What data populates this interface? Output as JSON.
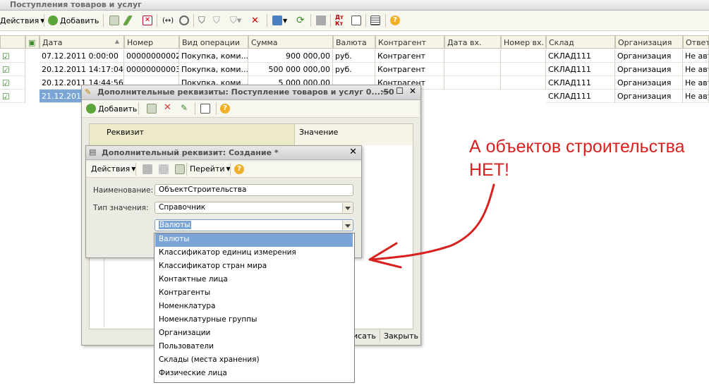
{
  "main_window": {
    "title": "Поступления товаров и услуг"
  },
  "toolbar": {
    "actions": "Действия",
    "add": "Добавить"
  },
  "table": {
    "headers": [
      "Дата",
      "Номер",
      "Вид операции",
      "Сумма",
      "Валюта",
      "Контрагент",
      "Дата вх.",
      "Номер вх.",
      "Склад",
      "Организация",
      "Ответс"
    ],
    "rows": [
      [
        "07.12.2011 0:00:00",
        "00000000002",
        "Покупка, коми...",
        "900 000,00",
        "руб.",
        "Контрагент",
        "",
        "",
        "СКЛАД111",
        "Организация",
        "Не авт"
      ],
      [
        "20.12.2011 14:17:04",
        "00000000003",
        "Покупка, коми...",
        "500 000 000,00",
        "руб.",
        "Контрагент",
        "",
        "",
        "СКЛАД111",
        "Организация",
        "Не авт"
      ],
      [
        "20.12.2011 14:44:56",
        "",
        "Покупка, коми...",
        "5 000 000,00",
        "",
        "Контрагент",
        "",
        "",
        "СКЛАД111",
        "Организация",
        "Не авт"
      ],
      [
        "21.12.2011",
        "",
        "",
        "",
        "",
        "",
        "",
        "",
        "СКЛАД111",
        "Организация",
        "Не авт"
      ]
    ]
  },
  "dialog1": {
    "title": "Дополнительные реквизиты: Поступление товаров и услуг 0...:50",
    "add": "Добавить",
    "col_rekvizit": "Реквизит",
    "col_value": "Значение",
    "write": "исать",
    "close": "Закрыть"
  },
  "dialog2": {
    "title": "Дополнительный реквизит: Создание *",
    "actions": "Действия",
    "goto": "Перейти",
    "name_label": "Наименование:",
    "name_value": "ОбъектСтроительства",
    "type_label": "Тип значения:",
    "type_value": "Справочник",
    "sub_value": "Валюты"
  },
  "dropdown": {
    "items": [
      "Валюты",
      "Классификатор единиц измерения",
      "Классификатор стран мира",
      "Контактные лица",
      "Контрагенты",
      "Номенклатура",
      "Номенклатурные группы",
      "Организации",
      "Пользователи",
      "Склады (места хранения)",
      "Физические лица"
    ]
  },
  "annotation": {
    "line1": "А объектов строительства",
    "line2": "НЕТ!"
  },
  "colors": {
    "selection": "#7aa5d6",
    "annotation": "#d8211f",
    "toolbar_bg": "#f7f6ef"
  }
}
